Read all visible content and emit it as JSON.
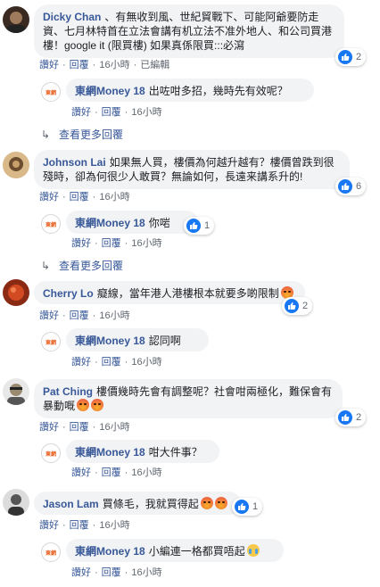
{
  "labels": {
    "like": "讚好",
    "reply": "回覆",
    "more_replies": "查看更多回覆"
  },
  "comments": [
    {
      "author": "Dicky Chan",
      "text": "、有無收到風、世紀貿戰下、可能阿爺要防走資、七月林特首在立法會講有机立法不准外地人、和公司買港樓！google it (限買樓) 如果真係限買:::必瀉",
      "time": "16小時",
      "edited": "已編輯",
      "likes": "2",
      "reply": {
        "author": "東網Money 18",
        "text": "出咗咁多招，幾時先有效呢？",
        "time": "16小時"
      },
      "more_replies": true
    },
    {
      "author": "Johnson Lai",
      "text": "如果無人買，樓價為何越升越有？樓價曾跌到很殘時，卻為何很少人敢買？無論如何，長遠来講系升的!",
      "time": "16小時",
      "likes": "6",
      "reply": {
        "author": "東網Money 18",
        "text": "你啱",
        "time": "16小時",
        "likes": "1"
      },
      "more_replies": true
    },
    {
      "author": "Cherry Lo",
      "text": "癡線，當年港人港樓根本就要多啲限制",
      "time": "16小時",
      "likes": "2",
      "reply": {
        "author": "東網Money 18",
        "text": "認同啊",
        "time": "16小時"
      }
    },
    {
      "author": "Pat Ching",
      "text": "樓價幾時先會有調整呢？社會咁兩極化，難保會有暴動嘅",
      "time": "16小時",
      "likes": "2",
      "reply": {
        "author": "東網Money 18",
        "text": "咁大件事？",
        "time": "16小時"
      }
    },
    {
      "author": "Jason Lam",
      "text": "買條毛，我就買得起",
      "time": "16小時",
      "likes": "1",
      "reply": {
        "author": "東網Money 18",
        "text": "小編連一格都買唔起",
        "time": "16小時"
      }
    }
  ],
  "colors": {
    "link": "#385898",
    "bubble": "#f2f3f5",
    "like_blue": "#1877f2"
  },
  "icons": {
    "like": "like-thumb-icon",
    "angry": "angry-emoji-icon",
    "cry": "crying-emoji-icon",
    "reply_arrow": "reply-arrow-icon"
  },
  "page_avatar_text": "東網"
}
